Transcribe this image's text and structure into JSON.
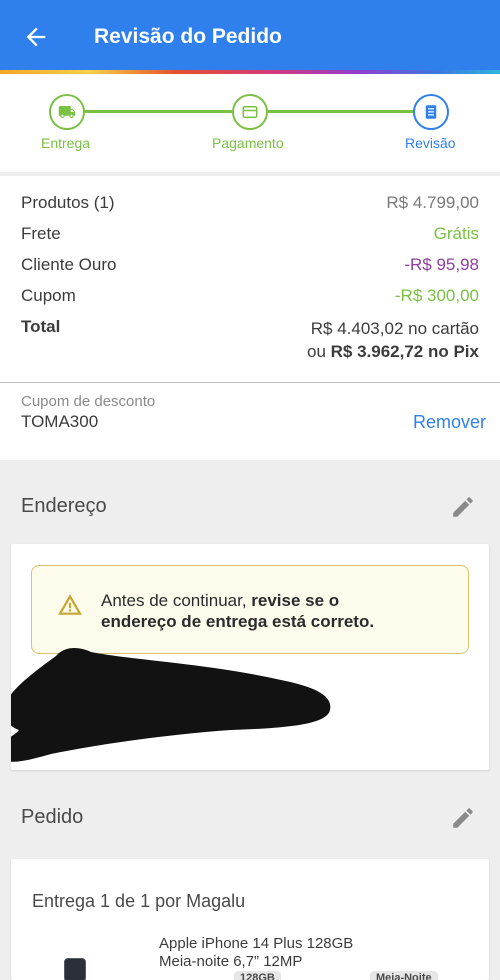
{
  "appbar": {
    "title": "Revisão do Pedido",
    "back_icon": "arrow-left-icon"
  },
  "colors": {
    "primary": "#2f80ed",
    "green": "#7ac143",
    "purple": "#8e3fa0"
  },
  "stepper": {
    "steps": [
      {
        "label": "Entrega",
        "icon": "truck-icon",
        "state": "done"
      },
      {
        "label": "Pagamento",
        "icon": "credit-card-icon",
        "state": "done"
      },
      {
        "label": "Revisão",
        "icon": "document-icon",
        "state": "active"
      }
    ]
  },
  "summary": {
    "products_label": "Produtos (1)",
    "products_value": "R$ 4.799,00",
    "shipping_label": "Frete",
    "shipping_value": "Grátis",
    "gold_label": "Cliente Ouro",
    "gold_value": "-R$ 95,98",
    "coupon_label": "Cupom",
    "coupon_value": "-R$ 300,00",
    "total_label": "Total",
    "total_card": "R$ 4.403,02 no cartão",
    "total_pix_prefix": "ou ",
    "total_pix_value": "R$ 3.962,72 no Pix"
  },
  "coupon": {
    "caption": "Cupom de desconto",
    "code": "TOMA300",
    "remove_label": "Remover"
  },
  "address": {
    "title": "Endereço",
    "warning_part1": "Antes de continuar, ",
    "warning_bold1": "revise se o",
    "warning_bold2": "endereço de entrega está correto."
  },
  "order": {
    "title": "Pedido",
    "delivery": "Entrega 1 de 1 por Magalu",
    "product_line1": "Apple iPhone 14 Plus 128GB",
    "product_line2": "Meia-noite 6,7” 12MP",
    "chip1": "128GB",
    "chip2": "Meia-Noite"
  }
}
